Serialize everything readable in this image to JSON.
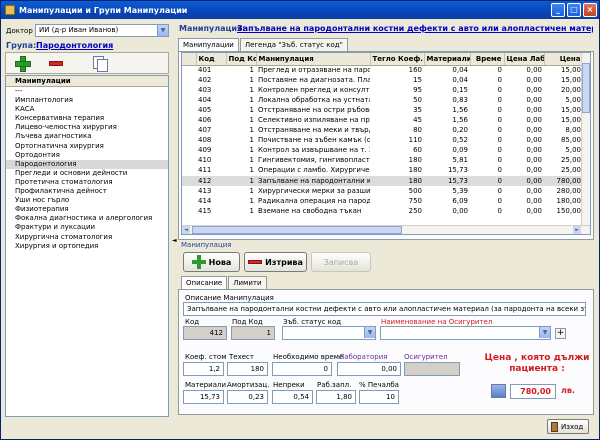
{
  "window": {
    "title": "Манипулации и Групи Манипулации",
    "buttons": [
      "_",
      "□",
      "×"
    ]
  },
  "left": {
    "doctor_label": "Доктор",
    "doctor_value": "ИИ (д-р Иван Иванов)",
    "group_label": "Група:",
    "group_value": "Пародонтология",
    "tree_header": "Манипулации",
    "tree_items": [
      "---",
      "Имплантология",
      "КАСА",
      "Консервативна терапия",
      "Лицево-челюстна хирургия",
      "Лъчева диагностика",
      "Ортогнатична хирургия",
      "Ортодонтия",
      "Пародонтология",
      "Прегледи и основни дейности",
      "Протетична стоматология",
      "Профилактична дейност",
      "Уши нос гърло",
      "Физиотерапия",
      "Фокална диагностика и алергология",
      "Фрактури и луксации",
      "Хирургична стоматология",
      "Хирургия и ортопедия"
    ],
    "tree_selected": "Пародонтология"
  },
  "header": {
    "manip_label": "Манипулация:",
    "manip_value": "Запълване на пародонтални костни дефекти с авто или алопластичен материал (за"
  },
  "tabs": [
    "Манипулации",
    "Легенда \"Зъб. статус код\""
  ],
  "grid": {
    "columns": [
      "Код",
      "Под Код",
      "Манипулация",
      "Тегло Коеф.",
      "Материали",
      "Време",
      "Цена Лаб.",
      "Цена"
    ],
    "rows": [
      [
        "401",
        "1",
        "Преглед и отразяване на пародо...",
        "160",
        "0,04",
        "0",
        "0,00",
        "15,00"
      ],
      [
        "402",
        "1",
        "Поставяне на диагнозата. Плани...",
        "15",
        "0,04",
        "0",
        "0,00",
        "15,00"
      ],
      [
        "403",
        "1",
        "Контролен преглед и консулта...",
        "95",
        "0,15",
        "0",
        "0,00",
        "20,00"
      ],
      [
        "404",
        "1",
        "Локална обработка на устната ...",
        "50",
        "0,83",
        "0",
        "0,00",
        "5,00"
      ],
      [
        "405",
        "1",
        "Отстраняване на остри ръбове ...",
        "35",
        "1,56",
        "0",
        "0,00",
        "15,00"
      ],
      [
        "406",
        "1",
        "Селективно изпиляване на пре...",
        "45",
        "1,56",
        "0",
        "0,00",
        "15,00"
      ],
      [
        "407",
        "1",
        "Отстраняване на меки и твърд...",
        "80",
        "0,20",
        "0",
        "0,00",
        "8,00"
      ],
      [
        "408",
        "1",
        "Почистване на зъбен камък (ок...",
        "110",
        "0,52",
        "0",
        "0,00",
        "85,00"
      ],
      [
        "409",
        "1",
        "Контрол за извършване на т. З...",
        "60",
        "0,09",
        "0",
        "0,00",
        "5,00"
      ],
      [
        "410",
        "1",
        "Гингивектомия, гингивопласти...",
        "180",
        "5,81",
        "0",
        "0,00",
        "25,00"
      ],
      [
        "411",
        "1",
        "Операции с ламбо. Хирургичен ...",
        "180",
        "15,73",
        "0",
        "0,00",
        "25,00"
      ],
      [
        "412",
        "1",
        "Запълване на пародонтални ко...",
        "180",
        "15,73",
        "0",
        "0,00",
        "780,00"
      ],
      [
        "413",
        "1",
        "Хирургически мерки за разшира...",
        "500",
        "5,39",
        "0",
        "0,00",
        "280,00"
      ],
      [
        "414",
        "1",
        "Радикална операция на пародо...",
        "750",
        "6,09",
        "0",
        "0,00",
        "180,00"
      ],
      [
        "415",
        "1",
        "Вземане на свободна тъкан",
        "250",
        "0,00",
        "0",
        "0,00",
        "150,00"
      ]
    ],
    "selected_code": "412"
  },
  "actions": {
    "section_label": "Манипулация",
    "new": "Нова",
    "delete": "Изтрива",
    "save": "Записва"
  },
  "detail_tabs": [
    "Описание",
    "Лимити"
  ],
  "detail": {
    "desc_label": "Описание Манипулация",
    "desc_value": "Запълване на пародонтални костни дефекти с авто или алопластичен материал (за пародонта на всеки зъб)*",
    "code_label": "Код",
    "code_value": "412",
    "subcode_label": "Под Код",
    "subcode_value": "1",
    "status_label": "Зъб. статус код",
    "status_value": "",
    "insurer_label": "Наименование на Осигурител",
    "insurer_value": "",
    "plus": "+",
    "coef_label": "Коеф. стом",
    "coef_value": "1,2",
    "tech_label": "Техест",
    "tech_value": "180",
    "time_label": "Необходимо време",
    "time_value": "0",
    "lab_label": "Лаборатория",
    "lab_value": "0,00",
    "insurer2_label": "Осигурител",
    "materials_label": "Материали",
    "materials_value": "15,73",
    "amort_label": "Амортизац.",
    "amort_value": "0,23",
    "overhead_label": "Непреки",
    "overhead_value": "0,54",
    "salary_label": "Раб.запл.",
    "salary_value": "1,80",
    "profit_label": "% Печалба",
    "profit_value": "10",
    "price_label": "Цена , която дължи пациента :",
    "price_value": "780,00",
    "currency": "лв."
  },
  "footer": {
    "exit": "Изход"
  },
  "colors": {
    "title_bar": "#0845b5",
    "accent_red": "#d21e1e",
    "link": "#0000c8"
  }
}
